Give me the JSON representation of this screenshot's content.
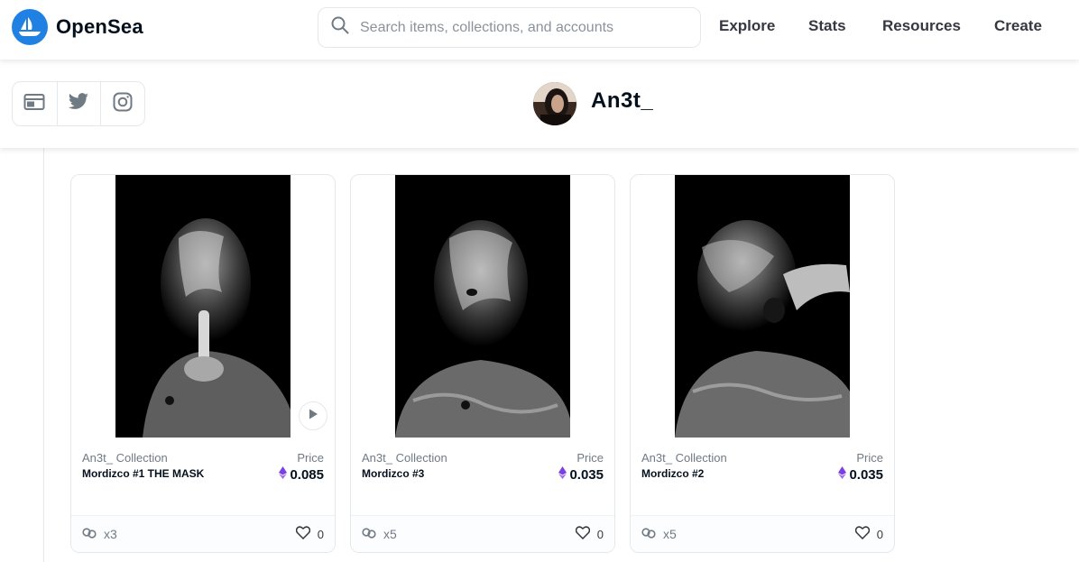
{
  "brand": {
    "name": "OpenSea",
    "accent": "#2081e2"
  },
  "search": {
    "placeholder": "Search items, collections, and accounts",
    "icon": "search-icon"
  },
  "nav": {
    "items": [
      {
        "label": "Explore"
      },
      {
        "label": "Stats"
      },
      {
        "label": "Resources"
      },
      {
        "label": "Create"
      }
    ]
  },
  "profile": {
    "username": "An3t_",
    "social": [
      "website-icon",
      "twitter-icon",
      "instagram-icon"
    ]
  },
  "cards": [
    {
      "collection": "An3t_ Collection",
      "name": "Mordizco #1 THE MASK",
      "price_label": "Price",
      "price": "0.085",
      "editions": "x3",
      "likes": "0",
      "has_play": true
    },
    {
      "collection": "An3t_ Collection",
      "name": "Mordizco #3",
      "price_label": "Price",
      "price": "0.035",
      "editions": "x5",
      "likes": "0",
      "has_play": false
    },
    {
      "collection": "An3t_ Collection",
      "name": "Mordizco #2",
      "price_label": "Price",
      "price": "0.035",
      "editions": "x5",
      "likes": "0",
      "has_play": false
    }
  ]
}
